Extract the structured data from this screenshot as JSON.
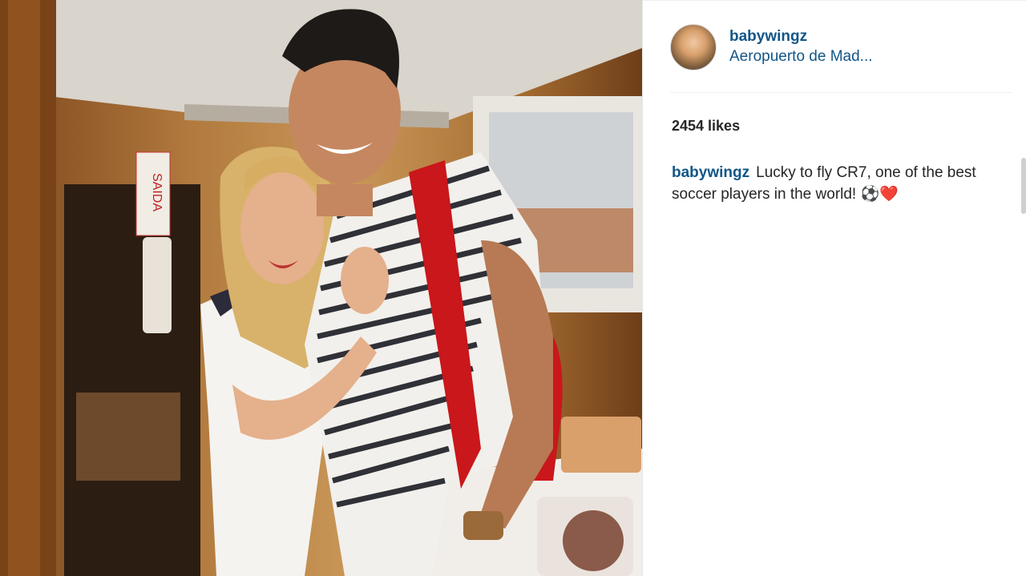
{
  "post": {
    "image_alt": "Photo",
    "author": {
      "username": "babywingz",
      "location": "Aeropuerto de Mad..."
    },
    "likes": "2454 likes",
    "caption": {
      "username": "babywingz",
      "text": "Lucky to fly CR7, one of the best soccer players in the world! ⚽❤️"
    }
  },
  "photo_details": {
    "sign_text": "SAIDA"
  },
  "colors": {
    "link": "#125688",
    "text": "#262626",
    "divider": "#efefef"
  }
}
